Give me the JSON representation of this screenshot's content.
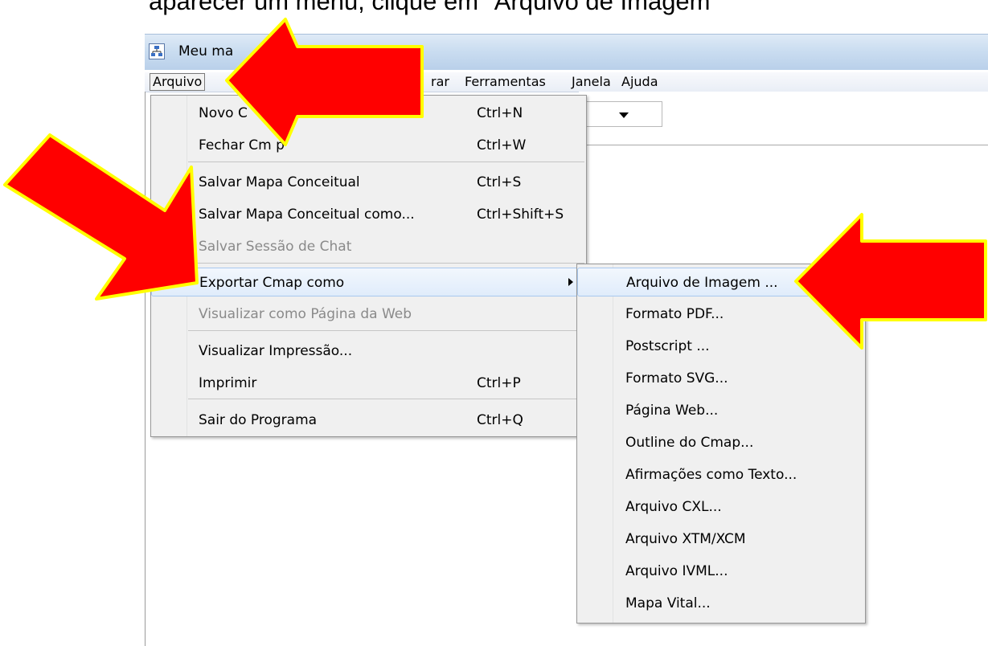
{
  "caption": "aparecer um menu, clique em \"Arquivo de Imagem\"",
  "window": {
    "title": "Meu ma",
    "icon": "concept-map-app-icon"
  },
  "menubar": [
    {
      "label": "Arquivo",
      "active": true
    },
    {
      "label": "rar"
    },
    {
      "label": "Ferramentas"
    },
    {
      "label": "Janela"
    },
    {
      "label": "Ajuda"
    }
  ],
  "file_menu": {
    "items": [
      {
        "label": "Novo C",
        "shortcut": "Ctrl+N"
      },
      {
        "label": "Fechar Cm   p",
        "shortcut": "Ctrl+W"
      },
      {
        "label": "Salvar Mapa Conceitual",
        "shortcut": "Ctrl+S"
      },
      {
        "label": "Salvar Mapa Conceitual como...",
        "shortcut": "Ctrl+Shift+S"
      },
      {
        "label": "Salvar Sessão de Chat",
        "shortcut": "",
        "disabled": true
      },
      {
        "label": "Exportar Cmap como",
        "shortcut": "",
        "highlighted": true,
        "submenu_indicator": "chevron-right-icon"
      },
      {
        "label": "Visualizar como Página da Web",
        "shortcut": "",
        "disabled": true
      },
      {
        "label": "Visualizar Impressão...",
        "shortcut": ""
      },
      {
        "label": "Imprimir",
        "shortcut": "Ctrl+P"
      },
      {
        "label": "Sair do Programa",
        "shortcut": "Ctrl+Q"
      }
    ]
  },
  "export_submenu": {
    "items": [
      {
        "label": "Arquivo de Imagem ...",
        "highlighted": true
      },
      {
        "label": "Formato PDF..."
      },
      {
        "label": "Postscript ..."
      },
      {
        "label": "Formato SVG..."
      },
      {
        "label": "Página Web..."
      },
      {
        "label": "Outline do Cmap..."
      },
      {
        "label": "Afirmações como Texto..."
      },
      {
        "label": "Arquivo CXL..."
      },
      {
        "label": "Arquivo XTM/XCM"
      },
      {
        "label": "Arquivo IVML..."
      },
      {
        "label": "Mapa Vital..."
      }
    ]
  },
  "annotations": {
    "arrow_fill": "#ff0000",
    "arrow_stroke": "#ffff00",
    "arrows": [
      "pointer-arrow-arquivo",
      "pointer-arrow-exportar",
      "pointer-arrow-arquivo-de-imagem"
    ]
  }
}
